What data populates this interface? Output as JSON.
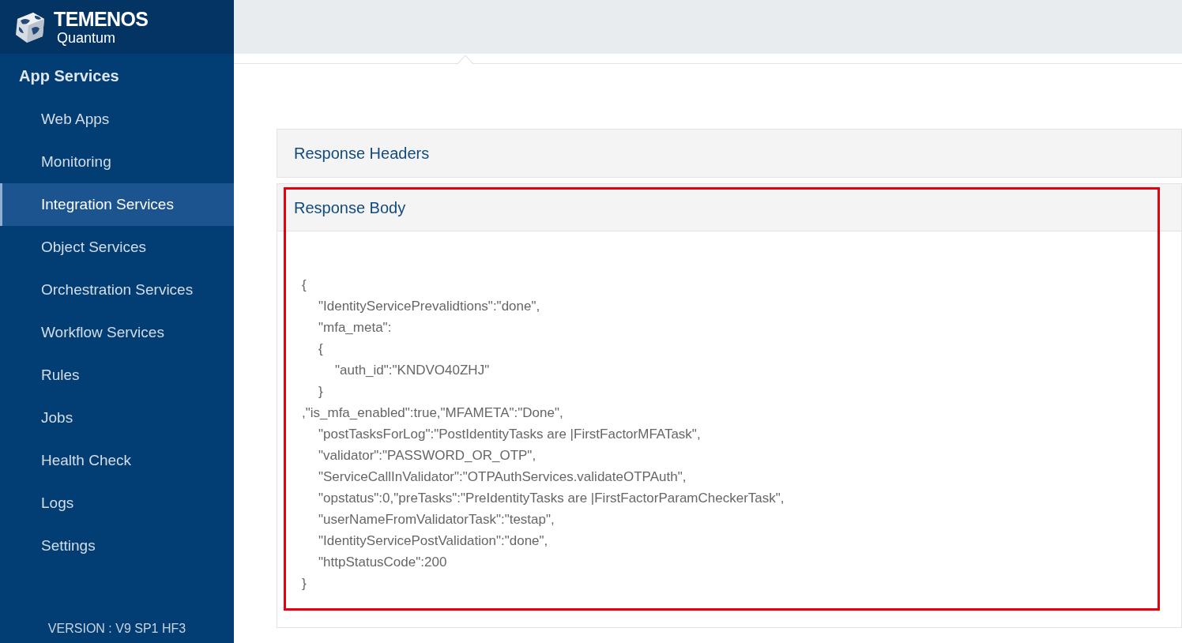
{
  "brand": {
    "name": "TEMENOS",
    "product": "Quantum"
  },
  "sidebar": {
    "section": "App Services",
    "items": [
      {
        "label": "Web Apps",
        "selected": false
      },
      {
        "label": "Monitoring",
        "selected": false
      },
      {
        "label": "Integration Services",
        "selected": true
      },
      {
        "label": "Object Services",
        "selected": false
      },
      {
        "label": "Orchestration Services",
        "selected": false
      },
      {
        "label": "Workflow Services",
        "selected": false
      },
      {
        "label": "Rules",
        "selected": false
      },
      {
        "label": "Jobs",
        "selected": false
      },
      {
        "label": "Health Check",
        "selected": false
      },
      {
        "label": "Logs",
        "selected": false
      },
      {
        "label": "Settings",
        "selected": false
      }
    ],
    "version": "VERSION : V9 SP1 HF3"
  },
  "panels": [
    {
      "title": "Response Headers",
      "highlighted": false
    },
    {
      "title": "Response Body",
      "highlighted": true,
      "body": [
        {
          "text": "{",
          "children": [
            {
              "text": "\"IdentityServicePrevalidtions\":\"done\","
            },
            {
              "text": "\"mfa_meta\":"
            },
            {
              "text": "{",
              "children": [
                {
                  "text": "\"auth_id\":\"KNDVO40ZHJ\""
                }
              ]
            },
            {
              "text": "}"
            }
          ]
        },
        {
          "text": ",\"is_mfa_enabled\":true,\"MFAMETA\":\"Done\",",
          "children": [
            {
              "text": "\"postTasksForLog\":\"PostIdentityTasks are |FirstFactorMFATask\","
            },
            {
              "text": "\"validator\":\"PASSWORD_OR_OTP\","
            },
            {
              "text": "\"ServiceCallInValidator\":\"OTPAuthServices.validateOTPAuth\","
            },
            {
              "text": "\"opstatus\":0,\"preTasks\":\"PreIdentityTasks are |FirstFactorParamCheckerTask\","
            },
            {
              "text": "\"userNameFromValidatorTask\":\"testap\","
            },
            {
              "text": "\"IdentityServicePostValidation\":\"done\","
            },
            {
              "text": "\"httpStatusCode\":200"
            }
          ]
        },
        {
          "text": "}"
        }
      ]
    }
  ]
}
